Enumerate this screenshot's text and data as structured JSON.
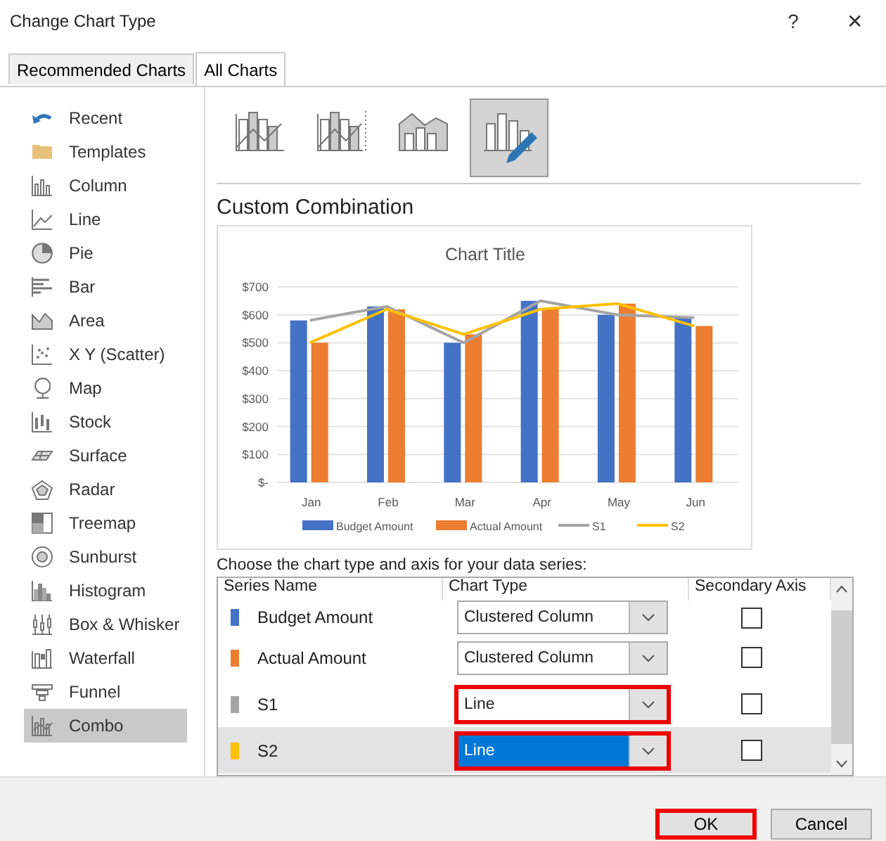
{
  "window": {
    "title": "Change Chart Type",
    "help": "?",
    "close": "✕"
  },
  "tabs": [
    {
      "label": "Recommended Charts",
      "selected": false
    },
    {
      "label": "All Charts",
      "selected": true
    }
  ],
  "sidebar": {
    "items": [
      {
        "label": "Recent",
        "selected": false
      },
      {
        "label": "Templates",
        "selected": false
      },
      {
        "label": "Column",
        "selected": false
      },
      {
        "label": "Line",
        "selected": false
      },
      {
        "label": "Pie",
        "selected": false
      },
      {
        "label": "Bar",
        "selected": false
      },
      {
        "label": "Area",
        "selected": false
      },
      {
        "label": "X Y (Scatter)",
        "selected": false
      },
      {
        "label": "Map",
        "selected": false
      },
      {
        "label": "Stock",
        "selected": false
      },
      {
        "label": "Surface",
        "selected": false
      },
      {
        "label": "Radar",
        "selected": false
      },
      {
        "label": "Treemap",
        "selected": false
      },
      {
        "label": "Sunburst",
        "selected": false
      },
      {
        "label": "Histogram",
        "selected": false
      },
      {
        "label": "Box & Whisker",
        "selected": false
      },
      {
        "label": "Waterfall",
        "selected": false
      },
      {
        "label": "Funnel",
        "selected": false
      },
      {
        "label": "Combo",
        "selected": true
      }
    ]
  },
  "subtypes": [
    {
      "selected": false
    },
    {
      "selected": false
    },
    {
      "selected": false
    },
    {
      "selected": true
    }
  ],
  "subtype_title": "Custom Combination",
  "chart": {
    "chart_data": {
      "type": "bar",
      "title": "Chart Title",
      "grid": true,
      "legend": true,
      "categories": [
        "Jan",
        "Feb",
        "Mar",
        "Apr",
        "May",
        "Jun"
      ],
      "ylim": [
        0,
        700
      ],
      "yticks": [
        {
          "value": 0,
          "label": "$-"
        },
        {
          "value": 100,
          "label": "$100"
        },
        {
          "value": 200,
          "label": "$200"
        },
        {
          "value": 300,
          "label": "$300"
        },
        {
          "value": 400,
          "label": "$400"
        },
        {
          "value": 500,
          "label": "$500"
        },
        {
          "value": 600,
          "label": "$600"
        },
        {
          "value": 700,
          "label": "$700"
        }
      ],
      "series": [
        {
          "name": "Budget Amount",
          "type": "bar",
          "color": "#4472c4",
          "values": [
            580,
            630,
            500,
            650,
            600,
            590
          ]
        },
        {
          "name": "Actual Amount",
          "type": "bar",
          "color": "#ed7d31",
          "values": [
            500,
            620,
            530,
            620,
            640,
            560
          ]
        },
        {
          "name": "S1",
          "type": "line",
          "color": "#a5a5a5",
          "values": [
            580,
            630,
            500,
            650,
            600,
            590
          ]
        },
        {
          "name": "S2",
          "type": "line",
          "color": "#ffc000",
          "values": [
            500,
            620,
            530,
            620,
            640,
            560
          ]
        }
      ]
    }
  },
  "series_prompt": "Choose the chart type and axis for your data series:",
  "series_table": {
    "columns": [
      "Series Name",
      "Chart Type",
      "Secondary Axis"
    ],
    "rows": [
      {
        "name": "Budget Amount",
        "color": "#4472c4",
        "chart_type": "Clustered Column",
        "secondary_axis": false,
        "selected": false,
        "highlighted": false
      },
      {
        "name": "Actual Amount",
        "color": "#ed7d31",
        "chart_type": "Clustered Column",
        "secondary_axis": false,
        "selected": false,
        "highlighted": false
      },
      {
        "name": "S1",
        "color": "#a5a5a5",
        "chart_type": "Line",
        "secondary_axis": false,
        "selected": false,
        "highlighted": true
      },
      {
        "name": "S2",
        "color": "#ffc000",
        "chart_type": "Line",
        "secondary_axis": false,
        "selected": true,
        "highlighted": true
      }
    ]
  },
  "buttons": [
    {
      "label": "OK",
      "highlighted": true
    },
    {
      "label": "Cancel",
      "highlighted": false
    }
  ]
}
